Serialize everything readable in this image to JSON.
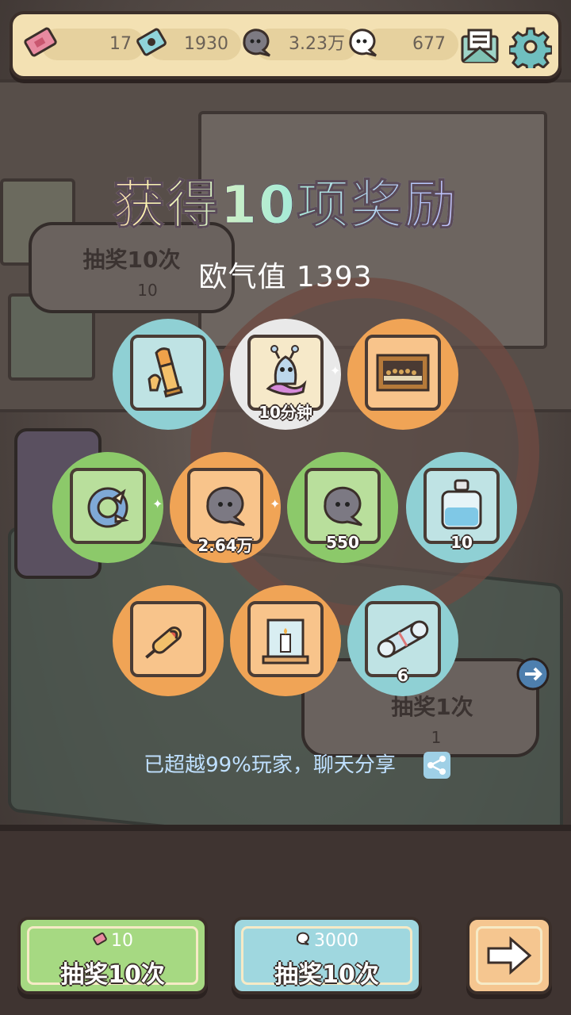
{
  "topbar": {
    "tickets": "17",
    "stamps": "1930",
    "coins": "3.23万",
    "ghosts": "677"
  },
  "background": {
    "bubble_left_label": "抽奖10次",
    "bubble_left_cost": "10",
    "bubble_right_label": "抽奖1次",
    "bubble_right_cost": "1"
  },
  "title": "获得10项奖励",
  "luck_value": "欧气值 1393",
  "rewards": [
    {
      "icon": "bullet-icon",
      "qty": "",
      "color": "blue"
    },
    {
      "icon": "slug-icon",
      "qty": "10分钟",
      "color": "white"
    },
    {
      "icon": "painting-icon",
      "qty": "",
      "color": "orange"
    },
    {
      "icon": "claw-amulet-icon",
      "qty": "",
      "color": "green"
    },
    {
      "icon": "coin-blob-icon",
      "qty": "2.64万",
      "color": "orange"
    },
    {
      "icon": "coin-blob-icon",
      "qty": "550",
      "color": "green"
    },
    {
      "icon": "potion-bottle-icon",
      "qty": "10",
      "color": "blue"
    },
    {
      "icon": "corn-dog-icon",
      "qty": "",
      "color": "orange"
    },
    {
      "icon": "candle-cube-icon",
      "qty": "",
      "color": "orange"
    },
    {
      "icon": "scroll-icon",
      "qty": "6",
      "color": "blue"
    }
  ],
  "share_text": "已超越99%玩家，聊天分享",
  "buttons": {
    "draw10_ticket_cost": "10",
    "draw10_ticket_label": "抽奖10次",
    "draw10_coin_cost": "3000",
    "draw10_coin_label": "抽奖10次"
  }
}
